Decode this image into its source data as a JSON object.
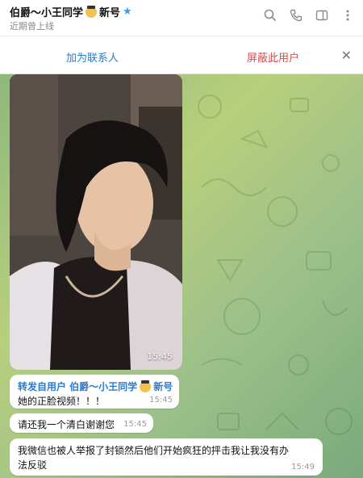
{
  "header": {
    "title": "伯爵～小王同学",
    "title_suffix": "新号",
    "status": "近期曾上线"
  },
  "action_bar": {
    "add_contact": "加为联系人",
    "block_user": "屏蔽此用户"
  },
  "messages": {
    "video_time": "15:45",
    "forward_label": "转发自用户 伯爵～小王同学",
    "forward_suffix": "新号",
    "msg1_text": "她的正脸视频！！！",
    "msg1_time": "15:45",
    "msg2_text": "请还我一个清白谢谢您",
    "msg2_time": "15:45",
    "msg3_text": "我微信也被人举报了封锁然后他们开始疯狂的抨击我让我没有办法反驳",
    "msg3_time": "15:49"
  },
  "colors": {
    "link_blue": "#2a7bd1",
    "danger_red": "#d84b4b",
    "star_blue": "#3d9be9"
  },
  "icons": [
    "search-icon",
    "phone-icon",
    "sidebar-icon",
    "more-vertical-icon",
    "close-icon",
    "star-icon",
    "emoji-icon"
  ]
}
